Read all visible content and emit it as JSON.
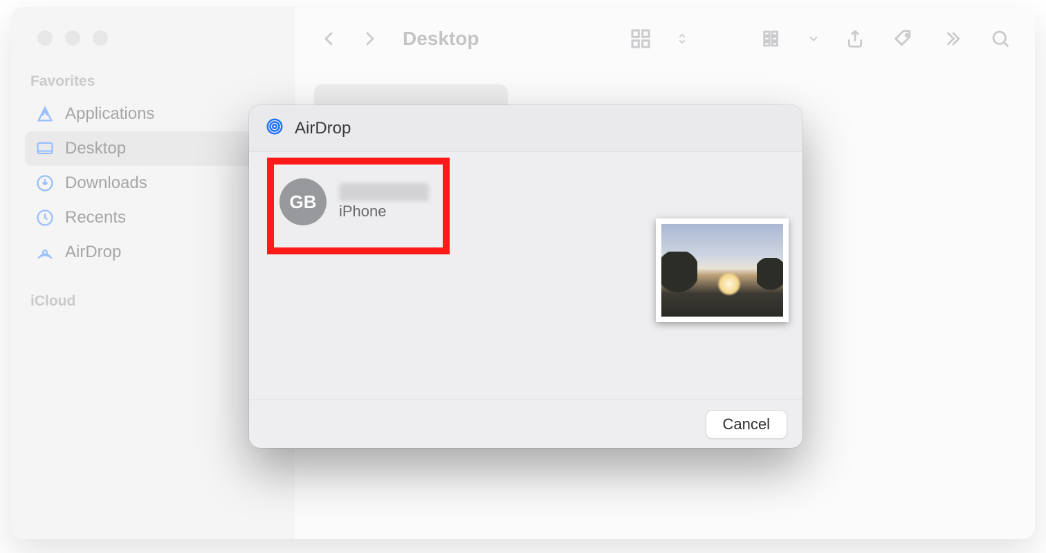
{
  "window": {
    "title": "Desktop"
  },
  "sidebar": {
    "sections": [
      {
        "label": "Favorites",
        "items": [
          {
            "label": "Applications"
          },
          {
            "label": "Desktop",
            "active": true
          },
          {
            "label": "Downloads"
          },
          {
            "label": "Recents"
          },
          {
            "label": "AirDrop"
          }
        ]
      },
      {
        "label": "iCloud",
        "items": []
      }
    ]
  },
  "dialog": {
    "title": "AirDrop",
    "target": {
      "initials": "GB",
      "device": "iPhone"
    },
    "cancel_label": "Cancel"
  }
}
